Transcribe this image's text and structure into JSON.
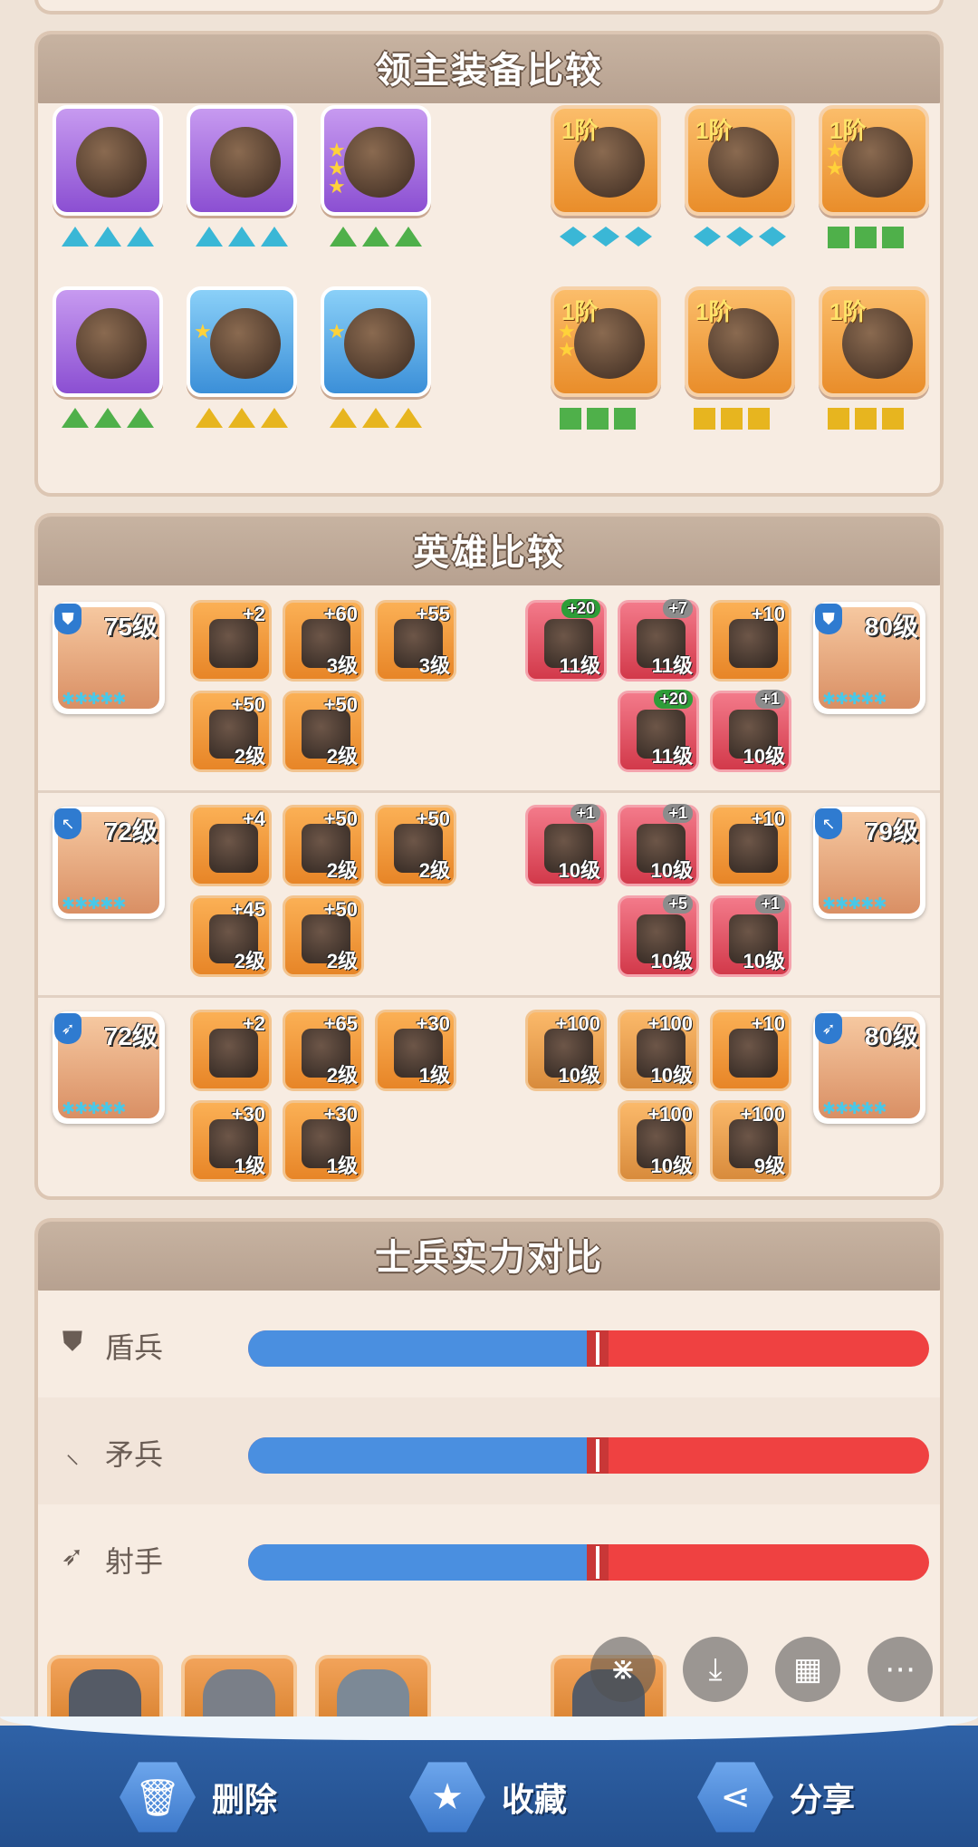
{
  "sections": {
    "lord_equipment_title": "领主装备比较",
    "hero_compare_title": "英雄比较",
    "troop_power_title": "士兵实力对比"
  },
  "lord_equipment": {
    "left": [
      {
        "name": "hat-icon",
        "rarity": "purple",
        "stars": 0,
        "gem_type": "tri",
        "gem_color": "#3ab7d6"
      },
      {
        "name": "wheel-icon",
        "rarity": "purple",
        "stars": 0,
        "gem_type": "tri",
        "gem_color": "#3ab7d6"
      },
      {
        "name": "coat-icon",
        "rarity": "purple",
        "stars": 3,
        "gem_type": "tri",
        "gem_color": "#4fb04a"
      },
      {
        "name": "pants-icon",
        "rarity": "purple",
        "stars": 0,
        "gem_type": "tri",
        "gem_color": "#4fb04a"
      },
      {
        "name": "ring-icon",
        "rarity": "blue",
        "stars": 1,
        "gem_type": "tri",
        "gem_color": "#e7b51f"
      },
      {
        "name": "hammer-icon",
        "rarity": "blue",
        "stars": 1,
        "gem_type": "tri",
        "gem_color": "#e7b51f"
      }
    ],
    "right": [
      {
        "name": "hat-icon",
        "tier": "1阶",
        "stars": 0,
        "gem_type": "dia",
        "gem_color": "#3ab7d6"
      },
      {
        "name": "wheel-icon",
        "tier": "1阶",
        "stars": 0,
        "gem_type": "dia",
        "gem_color": "#3ab7d6"
      },
      {
        "name": "coat-icon",
        "tier": "1阶",
        "stars": 2,
        "gem_type": "sq",
        "gem_color": "#4fb04a"
      },
      {
        "name": "pants-icon",
        "tier": "1阶",
        "stars": 2,
        "gem_type": "sq",
        "gem_color": "#4fb04a"
      },
      {
        "name": "ring-icon",
        "tier": "1阶",
        "stars": 0,
        "gem_type": "sq",
        "gem_color": "#e7b51f"
      },
      {
        "name": "hammer-icon",
        "tier": "1阶",
        "stars": 0,
        "gem_type": "sq",
        "gem_color": "#e7b51f"
      }
    ]
  },
  "heroes": [
    {
      "class_icon": "shield-icon",
      "left_level": "75级",
      "right_level": "80级",
      "left_items": [
        {
          "plus": "+2",
          "lv": ""
        },
        {
          "plus": "+60",
          "lv": "3级"
        },
        {
          "plus": "+55",
          "lv": "3级"
        },
        {
          "plus": "+50",
          "lv": "2级"
        },
        {
          "plus": "+50",
          "lv": "2级"
        }
      ],
      "right_items": [
        {
          "plus": "+20",
          "lv": "11级",
          "style": "red",
          "pill": "green"
        },
        {
          "plus": "+7",
          "lv": "11级",
          "style": "red",
          "pill": "gray"
        },
        {
          "plus": "+10",
          "lv": "",
          "style": "orange",
          "pill": ""
        },
        {
          "plus": "+20",
          "lv": "11级",
          "style": "red",
          "pill": "green"
        },
        {
          "plus": "+1",
          "lv": "10级",
          "style": "red",
          "pill": "gray"
        }
      ]
    },
    {
      "class_icon": "spear-icon",
      "left_level": "72级",
      "right_level": "79级",
      "left_items": [
        {
          "plus": "+4",
          "lv": ""
        },
        {
          "plus": "+50",
          "lv": "2级"
        },
        {
          "plus": "+50",
          "lv": "2级"
        },
        {
          "plus": "+45",
          "lv": "2级"
        },
        {
          "plus": "+50",
          "lv": "2级"
        }
      ],
      "right_items": [
        {
          "plus": "+1",
          "lv": "10级",
          "style": "red",
          "pill": "gray"
        },
        {
          "plus": "+1",
          "lv": "10级",
          "style": "red",
          "pill": "gray"
        },
        {
          "plus": "+10",
          "lv": "",
          "style": "orange",
          "pill": ""
        },
        {
          "plus": "+5",
          "lv": "10级",
          "style": "red",
          "pill": "gray"
        },
        {
          "plus": "+1",
          "lv": "10级",
          "style": "red",
          "pill": "gray"
        }
      ]
    },
    {
      "class_icon": "bow-icon",
      "left_level": "72级",
      "right_level": "80级",
      "left_items": [
        {
          "plus": "+2",
          "lv": ""
        },
        {
          "plus": "+65",
          "lv": "2级"
        },
        {
          "plus": "+30",
          "lv": "1级"
        },
        {
          "plus": "+30",
          "lv": "1级"
        },
        {
          "plus": "+30",
          "lv": "1级"
        }
      ],
      "right_items": [
        {
          "plus": "+100",
          "lv": "10级",
          "style": "brown",
          "pill": ""
        },
        {
          "plus": "+100",
          "lv": "10级",
          "style": "brown",
          "pill": ""
        },
        {
          "plus": "+10",
          "lv": "",
          "style": "orange",
          "pill": ""
        },
        {
          "plus": "+100",
          "lv": "10级",
          "style": "brown",
          "pill": ""
        },
        {
          "plus": "+100",
          "lv": "9级",
          "style": "brown",
          "pill": ""
        }
      ]
    }
  ],
  "troops": [
    {
      "icon": "shield-icon",
      "icon_glyph": "⛊",
      "label": "盾兵",
      "left_share": 0.5
    },
    {
      "icon": "spear-icon",
      "icon_glyph": "⸜",
      "label": "矛兵",
      "left_share": 0.5
    },
    {
      "icon": "bow-icon",
      "icon_glyph": "➶",
      "label": "射手",
      "left_share": 0.5
    }
  ],
  "toolbar": {
    "delete_label": "删除",
    "favorite_label": "收藏",
    "share_label": "分享"
  },
  "colors": {
    "left_side": "#4a8fe0",
    "right_side": "#ef4141",
    "toolbar_bg": "#2f62a7"
  }
}
